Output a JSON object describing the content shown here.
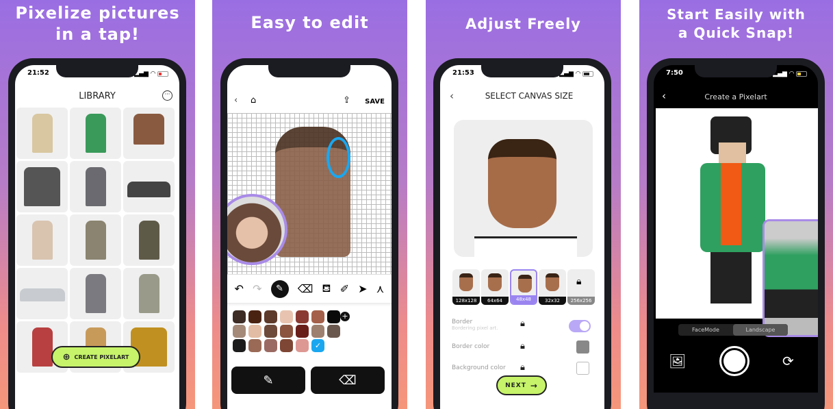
{
  "colors": {
    "accent_green": "#c6f36a",
    "accent_purple": "#9a85f0",
    "selection_blue": "#1aa7f0"
  },
  "panels": [
    {
      "headline": "Pixelize pictures in a tap!",
      "status_time": "21:52",
      "nav_title": "LIBRARY",
      "more_icon": "ellipsis-circle-icon",
      "create_button": "CREATE PIXELART"
    },
    {
      "headline": "Easy to edit",
      "save_label": "SAVE",
      "tools": [
        "undo",
        "redo",
        "pencil",
        "eraser",
        "fill-bucket",
        "eyedropper",
        "pointer",
        "mirror"
      ],
      "palette": [
        "#3c2c25",
        "#4a2212",
        "#5e3a2a",
        "#e8c4b0",
        "#8a3a32",
        "#a4604a",
        "#0a0a0a",
        "#a58a7a",
        "#e2bca4",
        "#6e4a3a",
        "#8a5440",
        "#6a1e1a",
        "#9e8070",
        "#6a584e",
        "#1c1c1c",
        "#9a6a56",
        "#9a6a62",
        "#7e4634",
        "#de9894",
        "#1aa7f0"
      ]
    },
    {
      "headline": "Adjust Freely",
      "status_time": "21:53",
      "nav_title": "SELECT CANVAS SIZE",
      "sizes": [
        {
          "label": "128x128",
          "locked": false
        },
        {
          "label": "64x64",
          "locked": false
        },
        {
          "label": "48x48",
          "locked": false,
          "selected": true
        },
        {
          "label": "32x32",
          "locked": false
        },
        {
          "label": "256x256",
          "locked": true
        }
      ],
      "border_label": "Border",
      "border_sub": "Bordering pixel art.",
      "border_on": true,
      "border_color_label": "Border color",
      "border_color": "#888888",
      "bg_color_label": "Background color",
      "bg_color": "#ffffff",
      "next_label": "NEXT"
    },
    {
      "headline": "Start Easily with a Quick Snap!",
      "status_time": "7:50",
      "nav_title": "Create a Pixelart",
      "modes": [
        "FaceMode",
        "Landscape"
      ],
      "active_mode": "Landscape"
    }
  ]
}
